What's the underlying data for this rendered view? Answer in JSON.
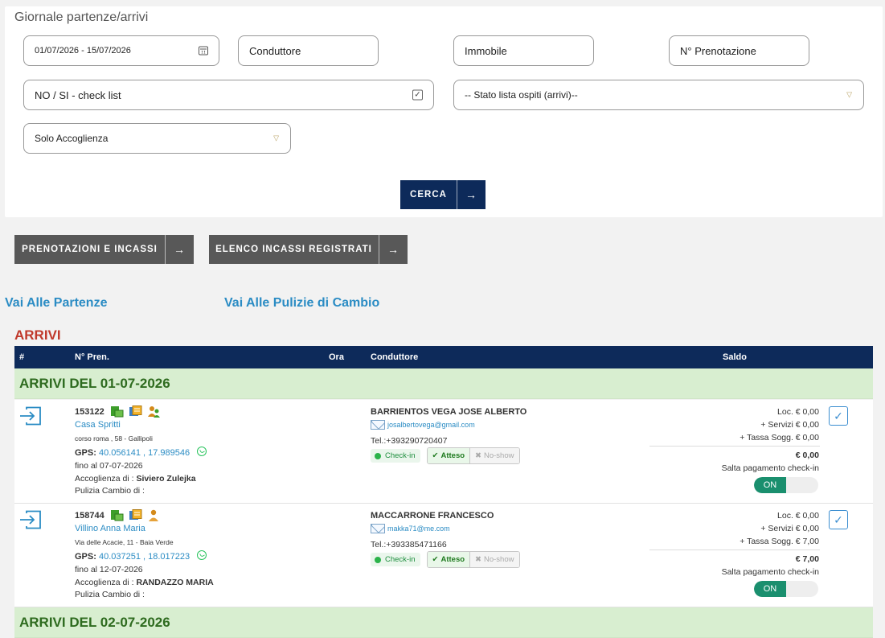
{
  "page": {
    "title": "Giornale partenze/arrivi"
  },
  "filters": {
    "date_range": "01/07/2026 - 15/07/2026",
    "conduttore": "Conduttore",
    "immobile": "Immobile",
    "prenotazione": "N° Prenotazione",
    "checklist": "NO / SI - check list",
    "stato_lista": "-- Stato lista ospiti (arrivi)--",
    "accoglienza": "Solo Accoglienza",
    "search_label": "CERCA"
  },
  "actions": {
    "prenotazioni": "PRENOTAZIONI E INCASSI",
    "elenco": "ELENCO INCASSI REGISTRATI"
  },
  "links": {
    "partenze": "Vai Alle Partenze",
    "pulizie": "Vai Alle Pulizie di Cambio"
  },
  "arrivi": {
    "title": "ARRIVI",
    "columns": {
      "hash": "#",
      "pren": "N° Pren.",
      "ora": "Ora",
      "conduttore": "Conduttore",
      "saldo": "Saldo"
    },
    "group1": "ARRIVI DEL  01-07-2026",
    "group2": "ARRIVI DEL  02-07-2026",
    "rows": [
      {
        "num": "153122",
        "name": "Casa Spritti",
        "address": "corso roma , 58 - Gallipoli",
        "gps_label": "GPS:",
        "gps": "40.056141 , 17.989546",
        "fino": "fino al 07-07-2026",
        "accoglienza_label": "Accoglienza di :",
        "accoglienza": "Siviero Zulejka",
        "pulizia": "Pulizia Cambio di :",
        "conduttore": "BARRIENTOS VEGA JOSE ALBERTO",
        "email": "josalbertovega@gmail.com",
        "tel": "Tel.:+393290720407",
        "checkin": "Check-in",
        "atteso": "Atteso",
        "noshow": "No-show",
        "loc": "Loc. € 0,00",
        "servizi": "+ Servizi € 0,00",
        "tassa": "+ Tassa Sogg. € 0,00",
        "total": "€ 0,00",
        "salta": "Salta pagamento check-in",
        "toggle": "ON"
      },
      {
        "num": "158744",
        "name": "Villino Anna Maria",
        "address": "Via delle Acacie, 11 - Baia Verde",
        "gps_label": "GPS:",
        "gps": "40.037251 , 18.017223",
        "fino": "fino al 12-07-2026",
        "accoglienza_label": "Accoglienza di :",
        "accoglienza": "RANDAZZO MARIA",
        "pulizia": "Pulizia Cambio di :",
        "conduttore": "MACCARRONE FRANCESCO",
        "email": "makka71@me.com",
        "tel": "Tel.:+393385471166",
        "checkin": "Check-in",
        "atteso": "Atteso",
        "noshow": "No-show",
        "loc": "Loc. € 0,00",
        "servizi": "+ Servizi € 0,00",
        "tassa": "+ Tassa Sogg. € 7,00",
        "total": "€ 7,00",
        "salta": "Salta pagamento check-in",
        "toggle": "ON"
      }
    ]
  },
  "colors": {
    "navy": "#0d2a5a",
    "link": "#2b8cc4",
    "arrivi_title": "#c0392b",
    "group_bg": "#d8eed0",
    "toggle_on": "#1a8f6e"
  }
}
